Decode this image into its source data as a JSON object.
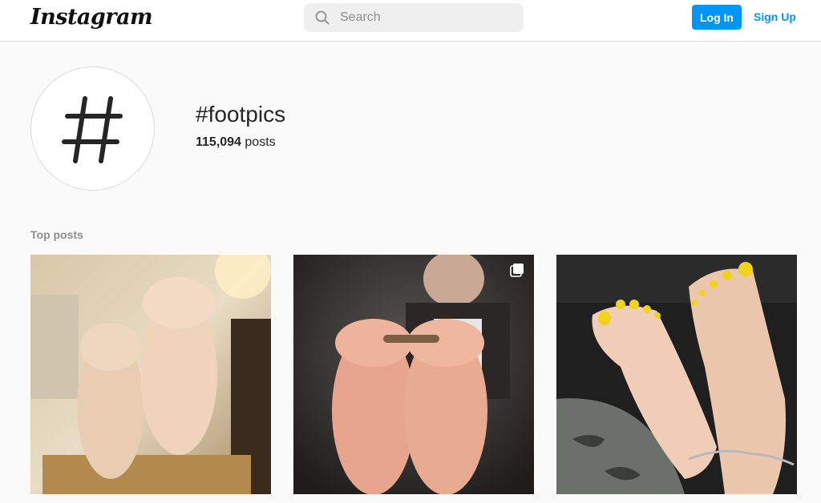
{
  "header": {
    "logo_text": "Instagram",
    "search_placeholder": "Search",
    "login_label": "Log In",
    "signup_label": "Sign Up"
  },
  "hashtag": {
    "title": "#footpics",
    "post_count": "115,094",
    "post_label": "posts"
  },
  "sections": {
    "top_posts_label": "Top posts"
  },
  "posts": [
    {
      "icon": "photo",
      "multiple": false
    },
    {
      "icon": "photo",
      "multiple": true
    },
    {
      "icon": "photo",
      "multiple": false
    }
  ],
  "colors": {
    "accent": "#0095f6",
    "background": "#fafafa",
    "border": "#dbdbdb",
    "muted_text": "#8e8e8e"
  }
}
